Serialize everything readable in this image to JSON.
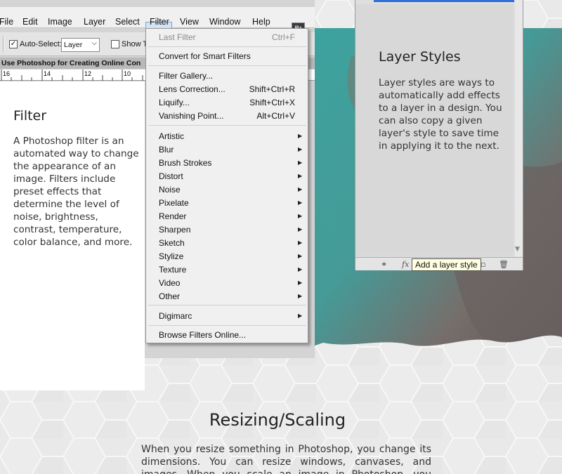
{
  "menubar": {
    "items": [
      "File",
      "Edit",
      "Image",
      "Layer",
      "Select",
      "Filter",
      "View",
      "Window",
      "Help"
    ],
    "badge": "Br"
  },
  "options_bar": {
    "auto_select_label": "Auto-Select:",
    "layer_dropdown": "Layer",
    "show_label": "Show T"
  },
  "document": {
    "title": "Use Photoshop for Creating Online Con",
    "ruler_ticks": [
      "16",
      "14",
      "12",
      "10"
    ]
  },
  "filter_menu": {
    "items": [
      {
        "label": "Last Filter",
        "shortcut": "Ctrl+F",
        "disabled": true
      },
      {
        "label": "Convert for Smart Filters"
      },
      {
        "label": "Filter Gallery..."
      },
      {
        "label": "Lens Correction...",
        "shortcut": "Shift+Ctrl+R"
      },
      {
        "label": "Liquify...",
        "shortcut": "Shift+Ctrl+X"
      },
      {
        "label": "Vanishing Point...",
        "shortcut": "Alt+Ctrl+V"
      },
      {
        "label": "Artistic",
        "submenu": true
      },
      {
        "label": "Blur",
        "submenu": true
      },
      {
        "label": "Brush Strokes",
        "submenu": true
      },
      {
        "label": "Distort",
        "submenu": true
      },
      {
        "label": "Noise",
        "submenu": true
      },
      {
        "label": "Pixelate",
        "submenu": true
      },
      {
        "label": "Render",
        "submenu": true
      },
      {
        "label": "Sharpen",
        "submenu": true
      },
      {
        "label": "Sketch",
        "submenu": true
      },
      {
        "label": "Stylize",
        "submenu": true
      },
      {
        "label": "Texture",
        "submenu": true
      },
      {
        "label": "Video",
        "submenu": true
      },
      {
        "label": "Other",
        "submenu": true
      },
      {
        "label": "Digimarc",
        "submenu": true
      },
      {
        "label": "Browse Filters Online..."
      }
    ]
  },
  "filter_card": {
    "heading": "Filter",
    "text": "A Photoshop filter is an automated way to change the appearance of an image. Filters include preset effects that determine the level of noise, brightness, contrast, temperature, color balance, and more."
  },
  "layer_styles": {
    "heading": "Layer Styles",
    "text": "Layer styles are ways to automatically add effects to a layer in a design. You can also copy a given layer's style to save time in applying it to the next.",
    "tooltip": "Add a layer style"
  },
  "resizing": {
    "heading": "Resizing/Scaling",
    "text": "When you resize something in Photoshop, you change its dimensions. You can resize windows, canvases, and images. When you scale an image in Photoshop, you change its"
  },
  "colors": {
    "accent_blue": "#2f6fd6",
    "teal": "#3aa8a4",
    "tooltip_bg": "#ffffe1"
  }
}
